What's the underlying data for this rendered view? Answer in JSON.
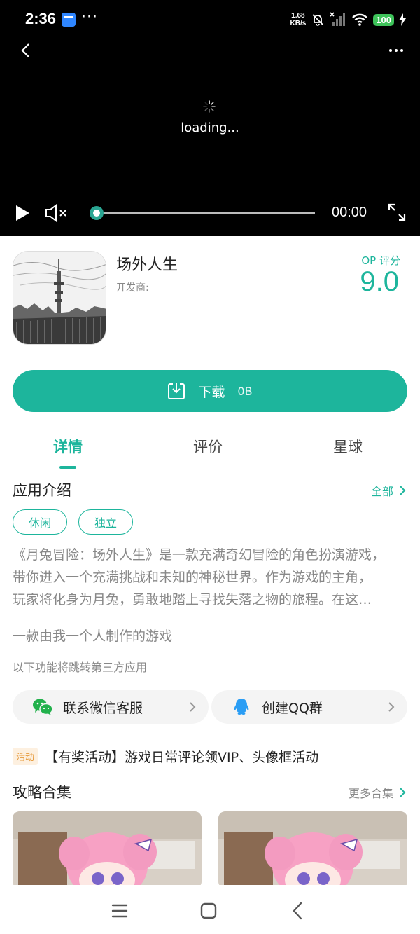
{
  "status_bar": {
    "time": "2:36",
    "dots": "···",
    "speed_value": "1.68",
    "speed_unit": "KB/s",
    "battery": "100"
  },
  "video": {
    "loading_text": "loading...",
    "current_time": "00:00",
    "progress": 0
  },
  "app": {
    "name": "场外人生",
    "developer_label": "开发商:",
    "score_label": "OP 评分",
    "score": "9.0"
  },
  "download": {
    "label": "下载",
    "size": "0B"
  },
  "tabs": [
    {
      "label": "详情",
      "active": true
    },
    {
      "label": "评价",
      "active": false
    },
    {
      "label": "星球",
      "active": false
    }
  ],
  "intro": {
    "title": "应用介绍",
    "all_label": "全部",
    "tags": [
      "休闲",
      "独立"
    ],
    "description_lines": [
      "《月兔冒险：场外人生》是一款充满奇幻冒险的角色扮演游戏，",
      "带你进入一个充满挑战和未知的神秘世界。作为游戏的主角，",
      "玩家将化身为月兔，勇敢地踏上寻找失落之物的旅程。在这…"
    ],
    "description_2": "一款由我一个人制作的游戏",
    "third_party_note": "以下功能将跳转第三方应用"
  },
  "contacts": {
    "wechat_label": "联系微信客服",
    "qq_label": "创建QQ群"
  },
  "activity": {
    "badge": "活动",
    "text": "【有奖活动】游戏日常评论领VIP、头像框活动"
  },
  "guides": {
    "title": "攻略合集",
    "more_label": "更多合集"
  },
  "colors": {
    "accent": "#1db59c",
    "activity_badge": "#e69a3c",
    "video_bg": "#000000"
  },
  "icons": [
    "back-icon",
    "more-icon",
    "play-icon",
    "mute-icon",
    "fullscreen-icon",
    "download-icon",
    "wechat-icon",
    "qq-icon",
    "menu-icon",
    "home-icon",
    "nav-back-icon"
  ]
}
